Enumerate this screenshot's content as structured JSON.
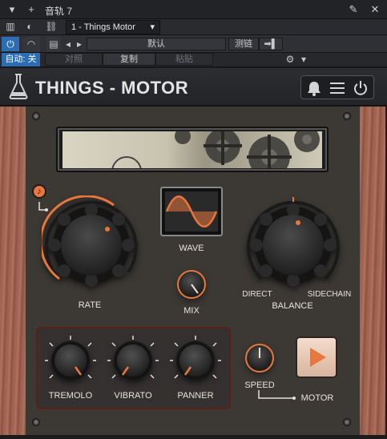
{
  "host": {
    "track_title": "音轨 7",
    "plugin_selector": "1 - Things Motor",
    "preset": "默认",
    "sidechain_label": "测链",
    "auto_label": "自动: 关",
    "compare_label": "对照",
    "copy_label": "复制",
    "paste_label": "粘贴"
  },
  "plugin": {
    "brand": "THINGS - MOTOR"
  },
  "controls": {
    "rate_label": "RATE",
    "wave_label": "WAVE",
    "mix_label": "MIX",
    "balance_label": "BALANCE",
    "direct_label": "DIRECT",
    "sidechain_label": "SIDECHAIN",
    "tremolo_label": "TREMOLO",
    "vibrato_label": "VIBRATO",
    "panner_label": "PANNER",
    "speed_label": "SPEED",
    "motor_label": "MOTOR"
  },
  "colors": {
    "accent": "#e8773d",
    "panel": "#3c3935",
    "wood": "#9c5f4b"
  }
}
